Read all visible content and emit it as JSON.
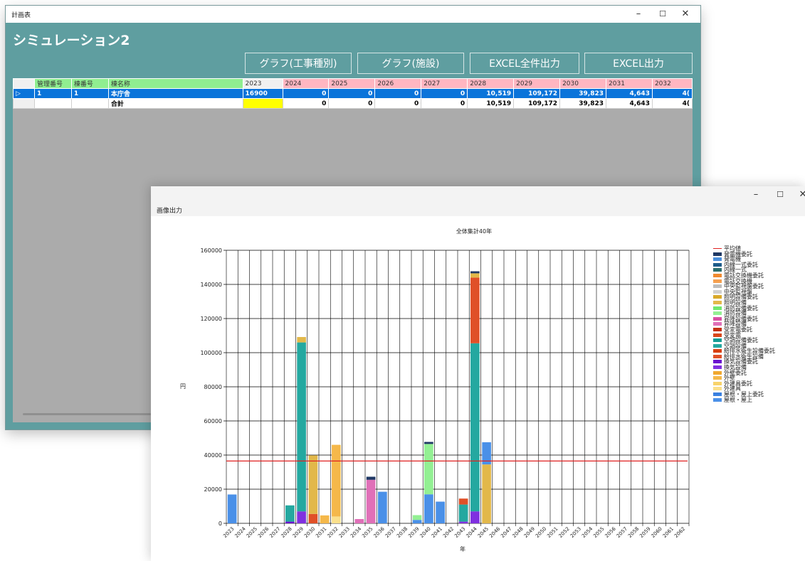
{
  "window1": {
    "title": "計画表",
    "heading": "シミュレーション2",
    "buttons": [
      "グラフ(工事種別)",
      "グラフ(施設)",
      "EXCEL全件出力",
      "EXCEL出力"
    ],
    "grid": {
      "columns": [
        "",
        "管理番号",
        "棟番号",
        "棟名称",
        "2023",
        "2024",
        "2025",
        "2026",
        "2027",
        "2028",
        "2029",
        "2030",
        "2031",
        "2032"
      ],
      "rows": [
        {
          "marker": "▷",
          "cells": [
            "1",
            "1",
            "本庁舎",
            "16900",
            "0",
            "0",
            "0",
            "0",
            "10,519",
            "109,172",
            "39,823",
            "4,643",
            "4("
          ]
        },
        {
          "marker": "",
          "cells": [
            "",
            "",
            "合計",
            "",
            "0",
            "0",
            "0",
            "0",
            "10,519",
            "109,172",
            "39,823",
            "4,643",
            "4("
          ]
        }
      ]
    }
  },
  "window2": {
    "menu": "画像出力"
  },
  "chart_data": {
    "type": "bar",
    "stacked": true,
    "title": "全体集計40年",
    "xlabel": "年",
    "ylabel": "円",
    "ylim": [
      0,
      160000
    ],
    "yticks": [
      0,
      20000,
      40000,
      60000,
      80000,
      100000,
      120000,
      140000,
      160000
    ],
    "categories": [
      "2023",
      "2024",
      "2025",
      "2026",
      "2027",
      "2028",
      "2029",
      "2030",
      "2031",
      "2032",
      "2033",
      "2034",
      "2035",
      "2036",
      "2037",
      "2038",
      "2039",
      "2040",
      "2041",
      "2042",
      "2043",
      "2044",
      "2045",
      "2046",
      "2047",
      "2048",
      "2049",
      "2050",
      "2051",
      "2052",
      "2053",
      "2054",
      "2055",
      "2056",
      "2057",
      "2058",
      "2059",
      "2060",
      "2061",
      "2062"
    ],
    "average": 36500,
    "legend_position": "right",
    "legend": [
      {
        "name": "平均値",
        "color": "#e02020",
        "kind": "line"
      },
      {
        "name": "発電機委託",
        "color": "#1f3864"
      },
      {
        "name": "発電機",
        "color": "#4a8fdc"
      },
      {
        "name": "内線一式委託",
        "color": "#1f5c8a"
      },
      {
        "name": "内線一式",
        "color": "#2c6f6f"
      },
      {
        "name": "電話交換機委託",
        "color": "#f08a30"
      },
      {
        "name": "電話交換機",
        "color": "#f5a050"
      },
      {
        "name": "中央監視盤委託",
        "color": "#bdbdbd"
      },
      {
        "name": "中央監視盤",
        "color": "#d0d0d0"
      },
      {
        "name": "照明設備委託",
        "color": "#d9a92a"
      },
      {
        "name": "照明設備",
        "color": "#e2b84a"
      },
      {
        "name": "消防設備委託",
        "color": "#6fe86f"
      },
      {
        "name": "消防設備",
        "color": "#93f093"
      },
      {
        "name": "昇降設備委託",
        "color": "#d94fa3"
      },
      {
        "name": "昇降設備",
        "color": "#e070b8"
      },
      {
        "name": "受変電委託",
        "color": "#c43010"
      },
      {
        "name": "受変電",
        "color": "#d9481c"
      },
      {
        "name": "空調設備委託",
        "color": "#139c94"
      },
      {
        "name": "空調設備",
        "color": "#24a8a0"
      },
      {
        "name": "給排水衛生設備委託",
        "color": "#d94010"
      },
      {
        "name": "給排水衛生設備",
        "color": "#e05028"
      },
      {
        "name": "換気設備委託",
        "color": "#6a10d0"
      },
      {
        "name": "換気設備",
        "color": "#8030e0"
      },
      {
        "name": "外壁委託",
        "color": "#f0a830"
      },
      {
        "name": "外壁",
        "color": "#f5b84a"
      },
      {
        "name": "外建具委託",
        "color": "#f8d36a"
      },
      {
        "name": "外建具",
        "color": "#fbe08c"
      },
      {
        "name": "屋根・屋上委託",
        "color": "#3a80e0"
      },
      {
        "name": "屋根・屋上",
        "color": "#4a90e8"
      }
    ],
    "bars": [
      {
        "x": "2023",
        "stack": [
          {
            "series": "屋根・屋上",
            "value": 16900
          }
        ]
      },
      {
        "x": "2028",
        "stack": [
          {
            "series": "換気設備委託",
            "value": 1000
          },
          {
            "series": "空調設備",
            "value": 9519
          }
        ]
      },
      {
        "x": "2029",
        "stack": [
          {
            "series": "換気設備",
            "value": 7000
          },
          {
            "series": "空調設備",
            "value": 99000
          },
          {
            "series": "照明設備",
            "value": 3172
          }
        ]
      },
      {
        "x": "2030",
        "stack": [
          {
            "series": "給排水衛生設備",
            "value": 5500
          },
          {
            "series": "照明設備",
            "value": 34323
          }
        ]
      },
      {
        "x": "2031",
        "stack": [
          {
            "series": "外壁",
            "value": 4643
          }
        ]
      },
      {
        "x": "2032",
        "stack": [
          {
            "series": "外建具",
            "value": 4000
          },
          {
            "series": "外壁",
            "value": 42000
          }
        ]
      },
      {
        "x": "2034",
        "stack": [
          {
            "series": "昇降設備",
            "value": 2500
          }
        ]
      },
      {
        "x": "2035",
        "stack": [
          {
            "series": "昇降設備",
            "value": 25500
          },
          {
            "series": "発電機委託",
            "value": 1800
          }
        ]
      },
      {
        "x": "2036",
        "stack": [
          {
            "series": "屋根・屋上",
            "value": 18500
          }
        ]
      },
      {
        "x": "2039",
        "stack": [
          {
            "series": "屋根・屋上",
            "value": 2000
          },
          {
            "series": "消防設備",
            "value": 2800
          }
        ]
      },
      {
        "x": "2040",
        "stack": [
          {
            "series": "屋根・屋上",
            "value": 17000
          },
          {
            "series": "消防設備",
            "value": 29500
          },
          {
            "series": "発電機委託",
            "value": 1200
          }
        ]
      },
      {
        "x": "2041",
        "stack": [
          {
            "series": "屋根・屋上",
            "value": 12700
          }
        ]
      },
      {
        "x": "2043",
        "stack": [
          {
            "series": "換気設備",
            "value": 1000
          },
          {
            "series": "空調設備",
            "value": 10000
          },
          {
            "series": "給排水衛生設備",
            "value": 3500
          }
        ]
      },
      {
        "x": "2044",
        "stack": [
          {
            "series": "換気設備",
            "value": 7000
          },
          {
            "series": "空調設備",
            "value": 98500
          },
          {
            "series": "給排水衛生設備",
            "value": 38500
          },
          {
            "series": "照明設備",
            "value": 2500
          },
          {
            "series": "発電機委託",
            "value": 1200
          }
        ]
      },
      {
        "x": "2045",
        "stack": [
          {
            "series": "照明設備",
            "value": 34500
          },
          {
            "series": "屋根・屋上",
            "value": 13000
          }
        ]
      }
    ]
  }
}
